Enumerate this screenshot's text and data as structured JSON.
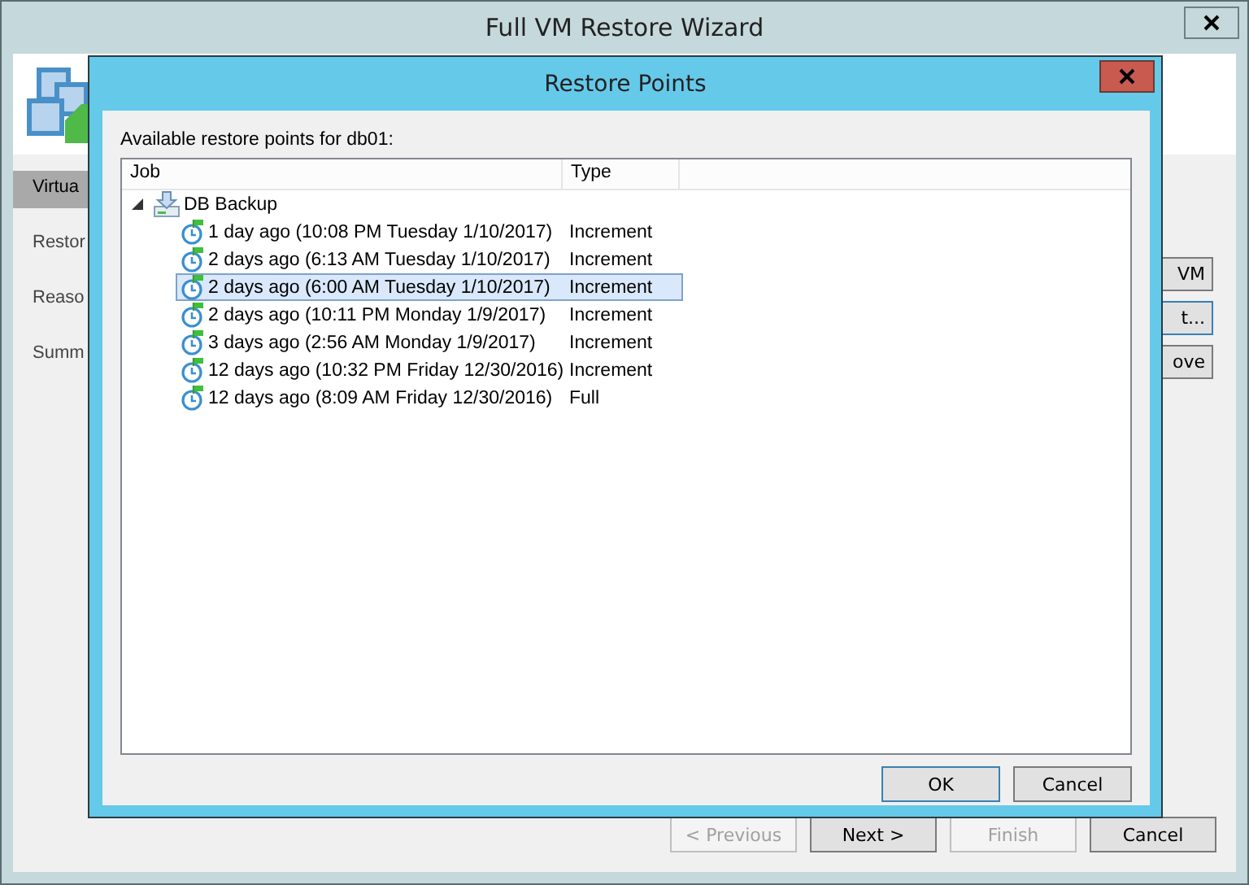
{
  "window": {
    "title": "Full VM Restore Wizard"
  },
  "nav": [
    {
      "label": "Virtua",
      "selected": true
    },
    {
      "label": "Restor",
      "selected": false
    },
    {
      "label": "Reaso",
      "selected": false
    },
    {
      "label": "Summ",
      "selected": false
    }
  ],
  "side_buttons": [
    {
      "label": "VM",
      "focused": false
    },
    {
      "label": "t...",
      "focused": true
    },
    {
      "label": "ove",
      "focused": false
    }
  ],
  "buttons": [
    {
      "label": "< Previous",
      "disabled": true
    },
    {
      "label": "Next >",
      "disabled": false
    },
    {
      "label": "Finish",
      "disabled": true
    },
    {
      "label": "Cancel",
      "disabled": false
    }
  ],
  "dialog": {
    "title": "Restore Points",
    "label": "Available restore points for db01:",
    "columns": [
      "Job",
      "Type"
    ],
    "tree": [
      {
        "name": "DB Backup",
        "expanded": true,
        "children": [
          {
            "name": "1 day ago (10:08 PM Tuesday 1/10/2017)",
            "type": "Increment",
            "selected": false
          },
          {
            "name": "2 days ago (6:13 AM Tuesday 1/10/2017)",
            "type": "Increment",
            "selected": false
          },
          {
            "name": "2 days ago (6:00 AM Tuesday 1/10/2017)",
            "type": "Increment",
            "selected": true
          },
          {
            "name": "2 days ago (10:11 PM Monday 1/9/2017)",
            "type": "Increment",
            "selected": false
          },
          {
            "name": "3 days ago (2:56 AM Monday 1/9/2017)",
            "type": "Increment",
            "selected": false
          },
          {
            "name": "12 days ago (10:32 PM Friday 12/30/2016)",
            "type": "Increment",
            "selected": false
          },
          {
            "name": "12 days ago (8:09 AM Friday 12/30/2016)",
            "type": "Full",
            "selected": false
          }
        ]
      }
    ],
    "buttons": [
      {
        "label": "OK",
        "default": true
      },
      {
        "label": "Cancel",
        "default": false
      }
    ]
  }
}
